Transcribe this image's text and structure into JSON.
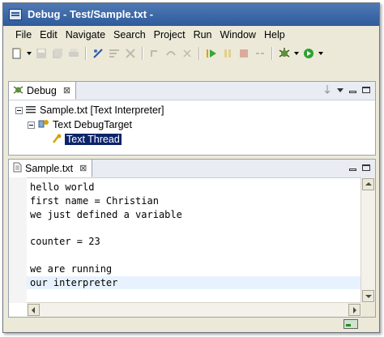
{
  "window": {
    "title": "Debug - Test/Sample.txt -"
  },
  "menu": [
    "File",
    "Edit",
    "Navigate",
    "Search",
    "Project",
    "Run",
    "Window",
    "Help"
  ],
  "debug_view": {
    "tab_label": "Debug",
    "tab_close": "⊠",
    "tree": [
      {
        "label": "Sample.txt [Text Interpreter]",
        "level": 0
      },
      {
        "label": "Text DebugTarget",
        "level": 1
      },
      {
        "label": "Text Thread",
        "level": 2,
        "selected": true
      }
    ]
  },
  "editor": {
    "tab_label": "Sample.txt",
    "tab_close": "⊠",
    "lines": [
      "hello world",
      "first name = Christian",
      "we just defined a variable",
      "",
      "counter = 23",
      "",
      "we are running",
      "our interpreter"
    ],
    "current_line_index": 7
  },
  "colors": {
    "selection": "#0a246a",
    "current_line": "#e8f2fe",
    "titlebar": "#2f5b9c"
  }
}
